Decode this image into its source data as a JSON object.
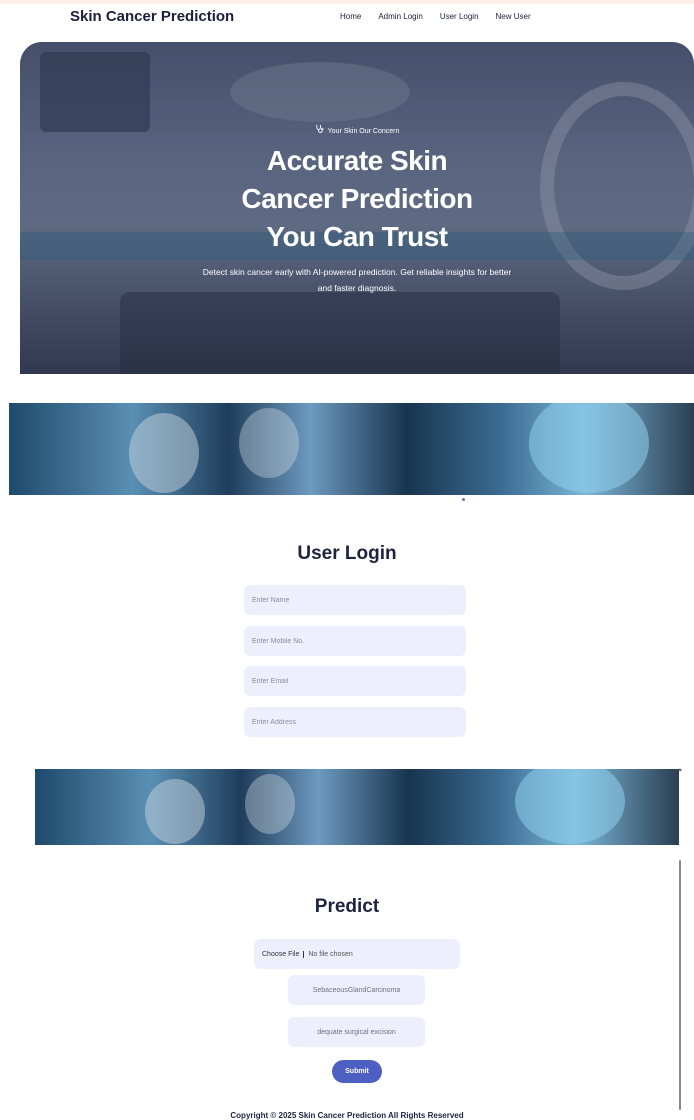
{
  "header": {
    "brand": "Skin Cancer Prediction",
    "nav": [
      "Home",
      "Admin Login",
      "User Login",
      "New User"
    ]
  },
  "hero": {
    "tag": "Your Skin Our Concern",
    "title": "Accurate Skin\nCancer Prediction\nYou Can Trust",
    "subtitle": "Detect skin cancer early with AI-powered prediction. Get reliable insights for better and faster diagnosis."
  },
  "login": {
    "title": "User Login",
    "fields": [
      {
        "placeholder": "Enter Name",
        "value": ""
      },
      {
        "placeholder": "Enter Mobile No.",
        "value": ""
      },
      {
        "placeholder": "Enter Email",
        "value": ""
      },
      {
        "placeholder": "Enter Address",
        "value": ""
      }
    ]
  },
  "predict": {
    "title": "Predict",
    "choose_file": "Choose File",
    "no_file": "No file chosen",
    "result_class": "SebaceousGlandCarcinoma",
    "result_treatment": "dequate surgical excision",
    "submit": "Submit"
  },
  "footer": {
    "text": "Copyright © 2025 Skin Cancer Prediction All Rights Reserved"
  },
  "colors": {
    "accent": "#4e5fc3",
    "field_bg": "#eeeffd",
    "text_dark": "#1d2240"
  },
  "icons": {
    "hero_tag": "stethoscope-icon"
  }
}
